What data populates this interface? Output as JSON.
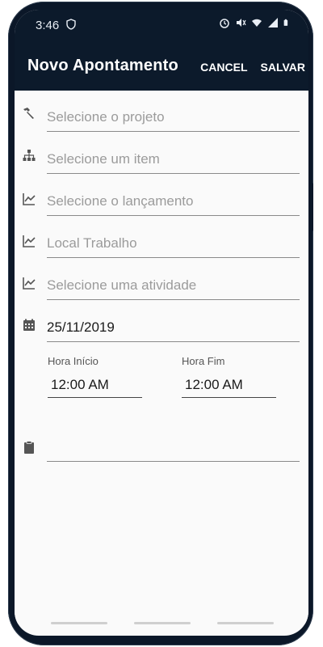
{
  "status_bar": {
    "time": "3:46",
    "icons": [
      "shield-icon",
      "alarm-icon",
      "mute-icon",
      "wifi-icon",
      "signal-icon",
      "battery-icon"
    ]
  },
  "app_bar": {
    "title": "Novo Apontamento",
    "cancel_label": "CANCEL",
    "save_label": "SALVAR"
  },
  "form": {
    "project_placeholder": "Selecione o projeto",
    "item_placeholder": "Selecione um item",
    "launch_placeholder": "Selecione o lançamento",
    "location_placeholder": "Local Trabalho",
    "activity_placeholder": "Selecione uma atividade",
    "date_value": "25/11/2019",
    "start_label": "Hora Início",
    "start_value": "12:00 AM",
    "end_label": "Hora Fim",
    "end_value": "12:00 AM",
    "notes_value": ""
  },
  "colors": {
    "app_bar": "#0c1a2b",
    "background": "#fafafa",
    "placeholder": "#9b9b9b",
    "text": "#1a1a1a"
  }
}
